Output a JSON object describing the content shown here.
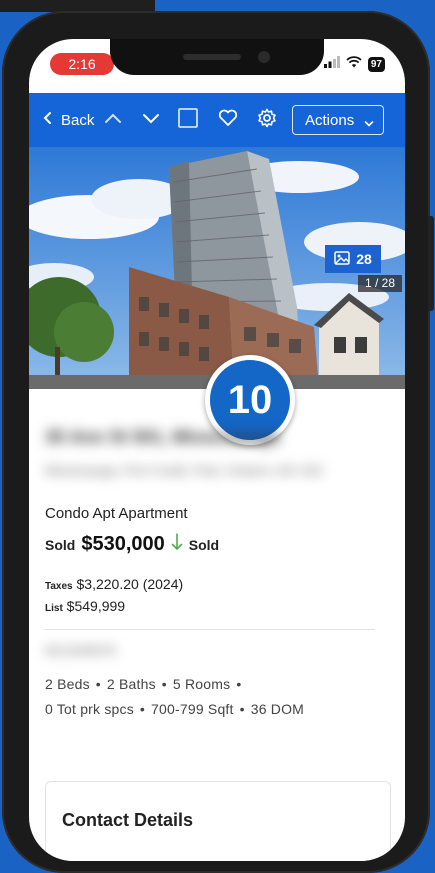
{
  "status": {
    "time": "2:16",
    "battery": "97"
  },
  "toolbar": {
    "back_label": "Back",
    "actions_label": "Actions"
  },
  "photo": {
    "count": "28",
    "index": "1 / 28"
  },
  "step_badge": "10",
  "listing": {
    "address_line1": "35 Ann St 501, Mississauga",
    "address_line2": "Mississauga, Port Credit, Peel, Ontario L5H 1E2",
    "property_type": "Condo Apt Apartment",
    "status_label": "Sold",
    "sold_price": "$530,000",
    "status_label_2": "Sold",
    "taxes_label": "Taxes",
    "taxes_value": "$3,220.20 (2024)",
    "list_label": "List",
    "list_value": "$549,999",
    "mls": "W12345678",
    "beds": "2 Beds",
    "baths": "2 Baths",
    "rooms": "5 Rooms",
    "parking": "0 Tot prk spcs",
    "sqft": "700-799 Sqft",
    "dom": "36 DOM"
  },
  "contact": {
    "title": "Contact Details"
  },
  "colors": {
    "toolbar": "#1565d8",
    "badge": "#1466c7",
    "sold_arrow": "#4caf50",
    "time_pill": "#e53935"
  }
}
